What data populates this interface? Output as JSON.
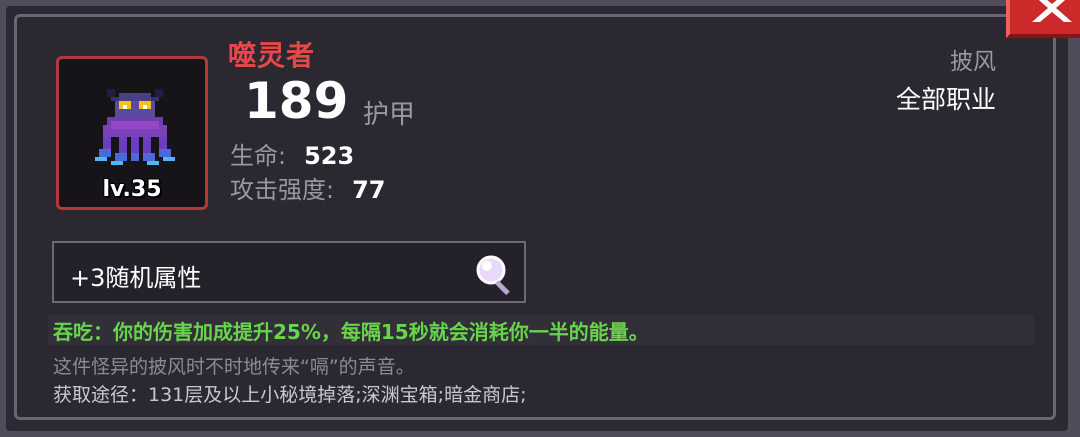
{
  "item": {
    "name": "噬灵者",
    "level": "lv.35",
    "armor_value": "189",
    "armor_label": "护甲",
    "stats": [
      {
        "label": "生命:",
        "value": "523"
      },
      {
        "label": "攻击强度:",
        "value": "77"
      }
    ],
    "slot_type": "披风",
    "job_class": "全部职业",
    "random_attributes": "+3随机属性",
    "effect": "吞吃：你的伤害加成提升25%，每隔15秒就会消耗你一半的能量。",
    "description": "这件怪异的披风时不时地传来“嗝”的声音。",
    "source": "获取途径：131层及以上小秘境掉落;深渊宝箱;暗金商店;"
  },
  "icons": {
    "close": "close-icon",
    "magnify": "magnifier-icon",
    "sprite": "cloak-monster-sprite"
  },
  "colors": {
    "name_rarity": "#e8474a",
    "effect": "#67d54a",
    "close_button": "#cc2a2a",
    "item_border": "#b23a3a"
  }
}
